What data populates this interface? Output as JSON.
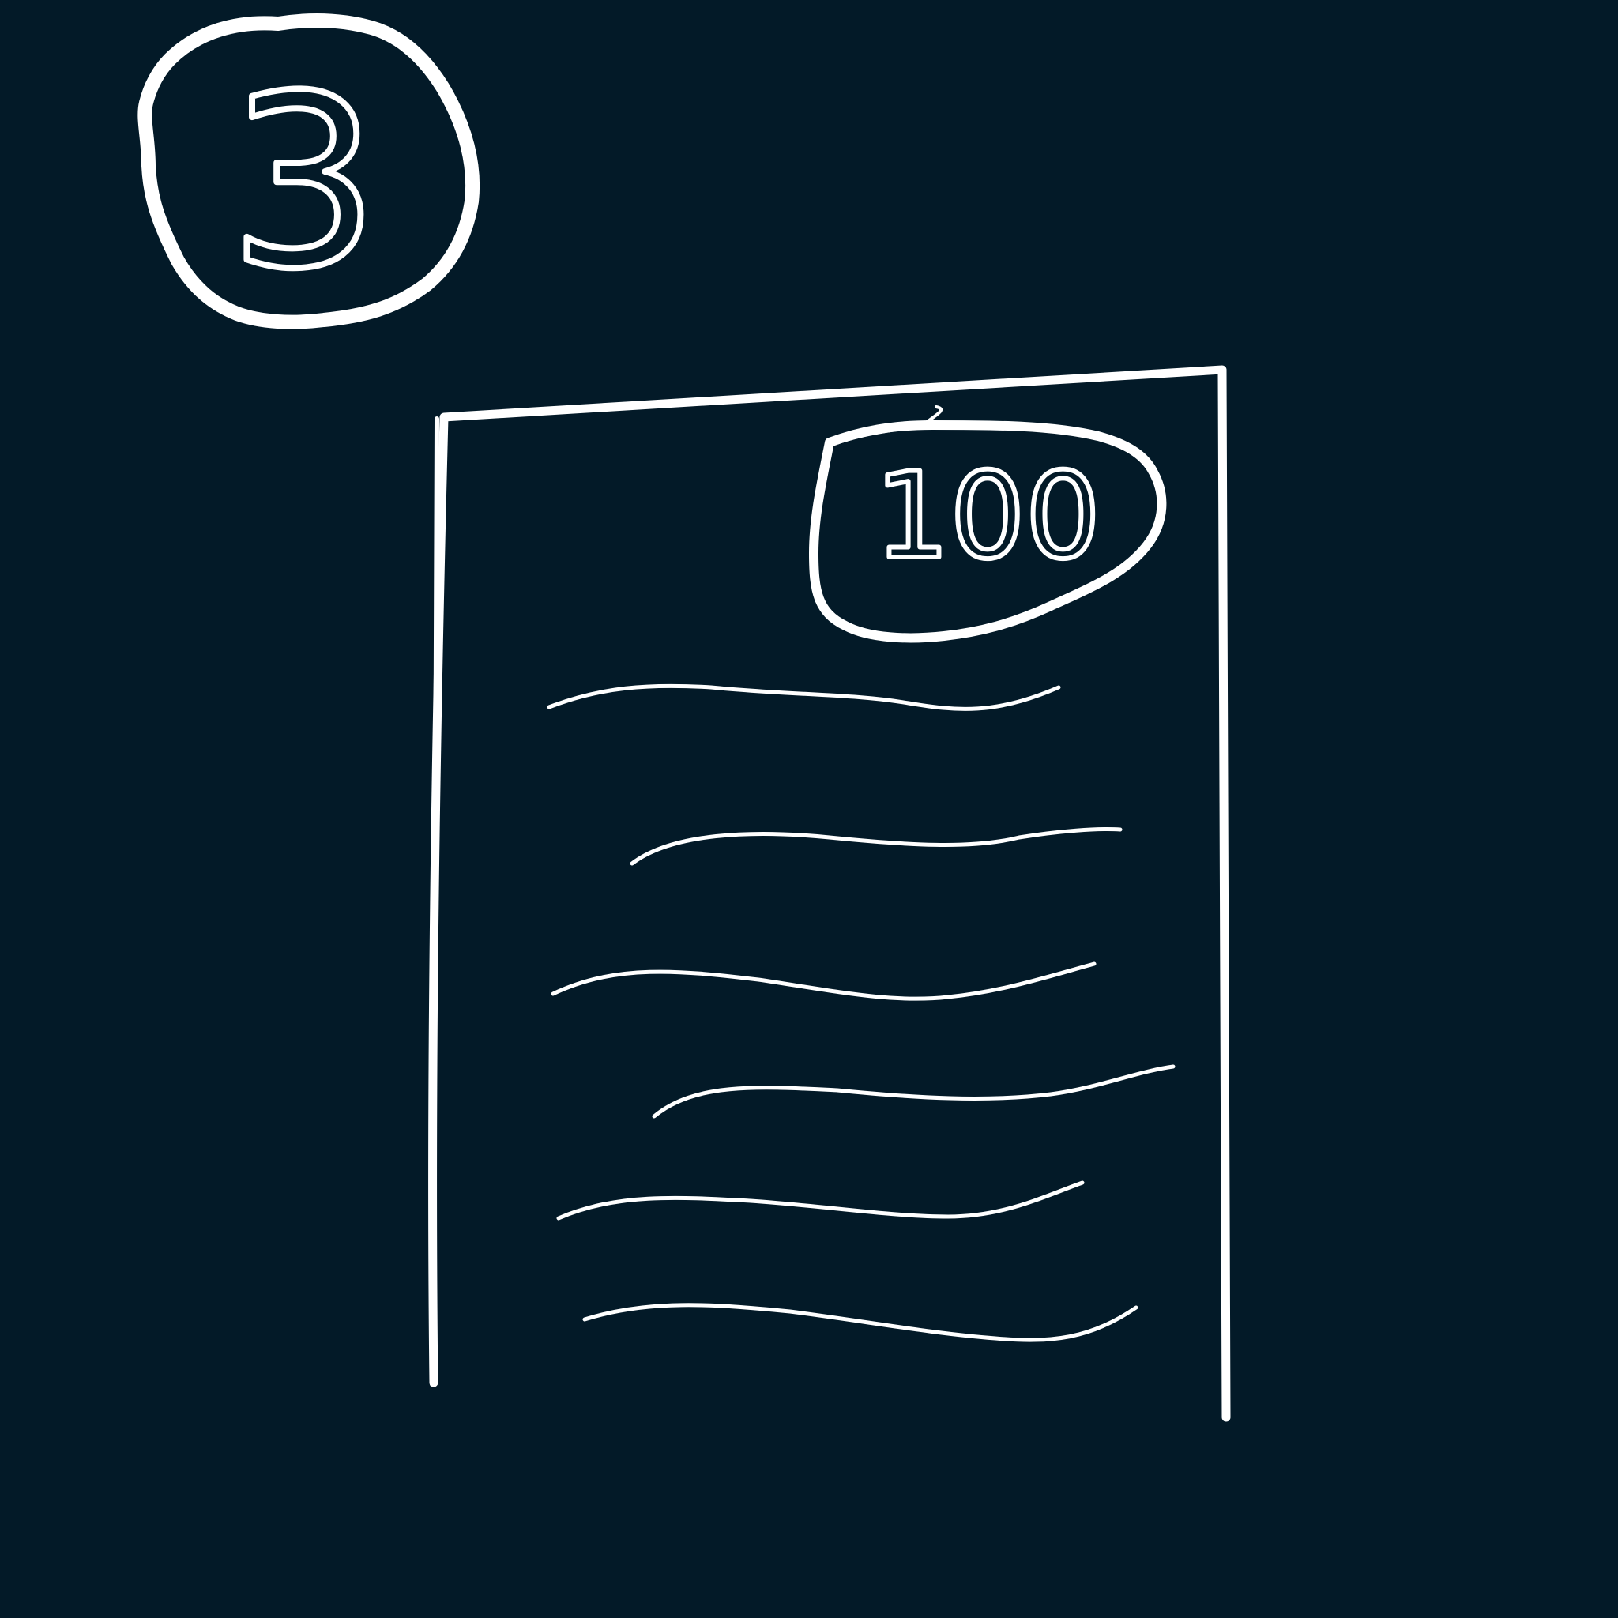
{
  "background_color": "#031a28",
  "ink_color": "#ffffff",
  "step_badge": {
    "number": "3",
    "shape": "hand-drawn-circle"
  },
  "document": {
    "shape": "hand-drawn-page-outline",
    "score_badge": {
      "value": "100",
      "shape": "hand-drawn-oval"
    },
    "text_line_count": 6
  }
}
